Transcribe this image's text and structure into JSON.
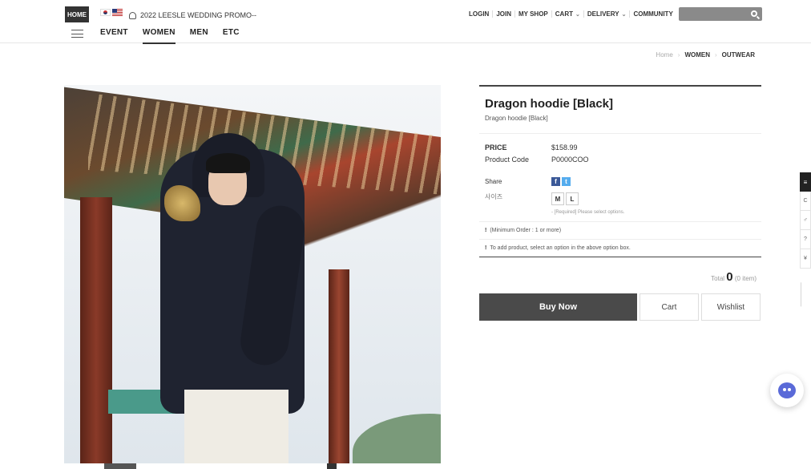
{
  "header": {
    "home_label": "HOME",
    "promo_text": "2022 LEESLE WEDDING PROMO--",
    "categories": [
      "EVENT",
      "WOMEN",
      "MEN",
      "ETC"
    ],
    "active_category": "WOMEN",
    "util": {
      "login": "LOGIN",
      "join": "JOIN",
      "my_shop": "MY SHOP",
      "cart": "CART",
      "delivery": "DELIVERY",
      "community": "COMMUNITY"
    },
    "search_value": ""
  },
  "breadcrumb": [
    "Home",
    "WOMEN",
    "OUTWEAR"
  ],
  "product": {
    "title": "Dragon hoodie [Black]",
    "subtitle": "Dragon hoodie [Black]",
    "price_label": "PRICE",
    "price": "$158.99",
    "code_label": "Product Code",
    "code": "P0000COO",
    "share_label": "Share",
    "size_label": "사이즈",
    "sizes": [
      "M",
      "L"
    ],
    "size_note": "- [Required] Please select options.",
    "notice_min": "(Minimum Order : 1 or more)",
    "notice_add": "To add product, select an option in the above option box.",
    "total_label": "Total",
    "total_count": "0",
    "total_items": "(0 item)"
  },
  "buttons": {
    "buy": "Buy Now",
    "cart": "Cart",
    "wishlist": "Wishlist"
  },
  "icons": {
    "facebook": "f",
    "twitter": "t",
    "menu_symbol": "≡",
    "side_cells": [
      "C",
      "♂",
      "?",
      "¥"
    ]
  }
}
